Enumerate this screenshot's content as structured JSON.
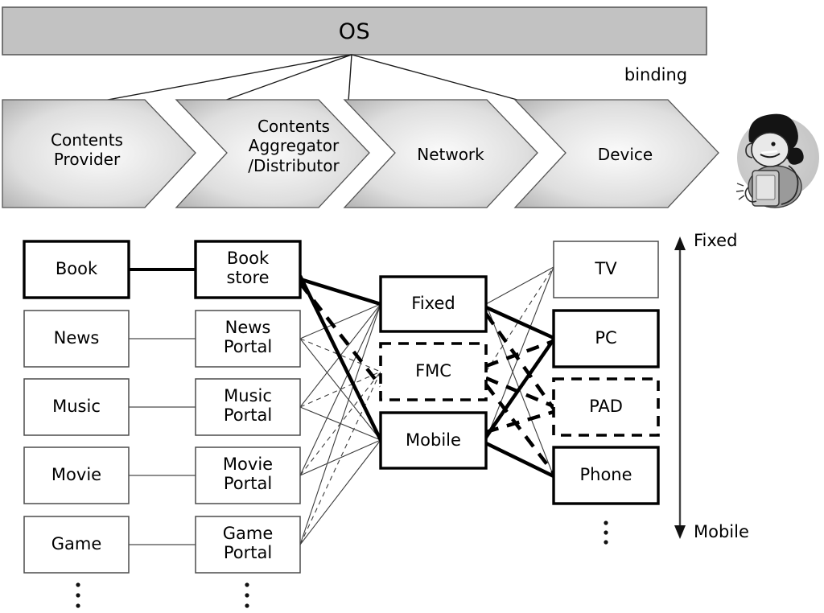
{
  "diagram": {
    "title_bar": {
      "label": "OS",
      "fill": "#c2c2c2",
      "stroke": "#5a5a5a"
    },
    "binding": {
      "label": "binding"
    },
    "value_chain": {
      "fill_light": "#f4f4f4",
      "fill_dark": "#b4b4b4",
      "stages": [
        {
          "id": "contents-provider",
          "label": "Contents\nProvider"
        },
        {
          "id": "contents-aggregator",
          "label": "Contents\nAggregator\n/Distributor"
        },
        {
          "id": "network",
          "label": "Network"
        },
        {
          "id": "device",
          "label": "Device"
        }
      ]
    },
    "user_avatar": {
      "name": "user-illustration"
    },
    "columns": {
      "contents": [
        {
          "id": "book",
          "label": "Book",
          "emphasis": "bold"
        },
        {
          "id": "news",
          "label": "News",
          "emphasis": "normal"
        },
        {
          "id": "music",
          "label": "Music",
          "emphasis": "normal"
        },
        {
          "id": "movie",
          "label": "Movie",
          "emphasis": "normal"
        },
        {
          "id": "game",
          "label": "Game",
          "emphasis": "normal"
        }
      ],
      "portals": [
        {
          "id": "book-store",
          "label": "Book\nstore",
          "emphasis": "bold"
        },
        {
          "id": "news-portal",
          "label": "News\nPortal",
          "emphasis": "normal"
        },
        {
          "id": "music-portal",
          "label": "Music\nPortal",
          "emphasis": "normal"
        },
        {
          "id": "movie-portal",
          "label": "Movie\nPortal",
          "emphasis": "normal"
        },
        {
          "id": "game-portal",
          "label": "Game\nPortal",
          "emphasis": "normal"
        }
      ],
      "networks": [
        {
          "id": "fixed",
          "label": "Fixed",
          "style": "solid-bold"
        },
        {
          "id": "fmc",
          "label": "FMC",
          "style": "dashed-bold"
        },
        {
          "id": "mobile",
          "label": "Mobile",
          "style": "solid-bold"
        }
      ],
      "devices": [
        {
          "id": "tv",
          "label": "TV",
          "style": "thin"
        },
        {
          "id": "pc",
          "label": "PC",
          "style": "solid-bold"
        },
        {
          "id": "pad",
          "label": "PAD",
          "style": "dashed-bold"
        },
        {
          "id": "phone",
          "label": "Phone",
          "style": "solid-bold"
        }
      ]
    },
    "ellipses": [
      {
        "id": "contents-more",
        "dots": 3
      },
      {
        "id": "portals-more",
        "dots": 3
      },
      {
        "id": "devices-more",
        "dots": 3
      }
    ],
    "axis": {
      "top_label": "Fixed",
      "bottom_label": "Mobile"
    }
  }
}
